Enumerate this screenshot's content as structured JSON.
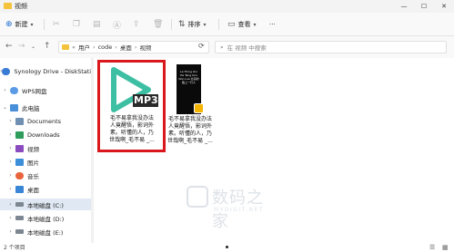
{
  "window": {
    "title": "视频",
    "controls": [
      "—",
      "☐",
      "✕"
    ]
  },
  "toolbar": {
    "new_label": "新建",
    "new_chevron": "▾",
    "sort_label": "排序",
    "view_label": "查看",
    "more_label": "···"
  },
  "address": {
    "prefix": "«",
    "segments": [
      "用户",
      "code",
      "桌面",
      "视频"
    ],
    "separator": "›",
    "search_placeholder": "在 视频 中搜索"
  },
  "sidebar": {
    "items": [
      {
        "label": "Synology Drive - DiskStation",
        "chevron": "›"
      },
      {
        "label": "WPS网盘",
        "chevron": "›"
      },
      {
        "label": "此电脑",
        "chevron": "⌄"
      },
      {
        "label": "Documents",
        "chevron": "›"
      },
      {
        "label": "Downloads",
        "chevron": "›"
      },
      {
        "label": "视频",
        "chevron": "›"
      },
      {
        "label": "图片",
        "chevron": "›"
      },
      {
        "label": "音乐",
        "chevron": "›"
      },
      {
        "label": "桌面",
        "chevron": "›"
      },
      {
        "label": "本地磁盘 (C:)",
        "chevron": "›"
      },
      {
        "label": "本地磁盘 (D:)",
        "chevron": "›"
      },
      {
        "label": "本地磁盘 (E:)",
        "chevron": "›"
      }
    ],
    "selected_index": 9
  },
  "files": [
    {
      "badge": "MP3",
      "caption_lines": [
        "毛不易拿我没办法",
        "人竟醒悟，影词外",
        "素。听懂的人，乃",
        "世哉啊_毛不易 _..."
      ]
    },
    {
      "cover_text": "Le Thing Ovi Ha Teng Uns Non Lue 北凉的路上一行人",
      "caption_lines": [
        "毛不易拿我没办法",
        "人竟醒悟，影词外",
        "素。听懂的人，乃",
        "世哉啊_毛不易 _..."
      ]
    }
  ],
  "watermark": {
    "text": "数码之家",
    "sub": "MYDIGIT.NET"
  },
  "status": {
    "count_text": "2 个项目"
  },
  "colors": {
    "highlight_border": "#d9171c",
    "play_icon": "#3dbfa3",
    "folder": "#f4c33b"
  }
}
